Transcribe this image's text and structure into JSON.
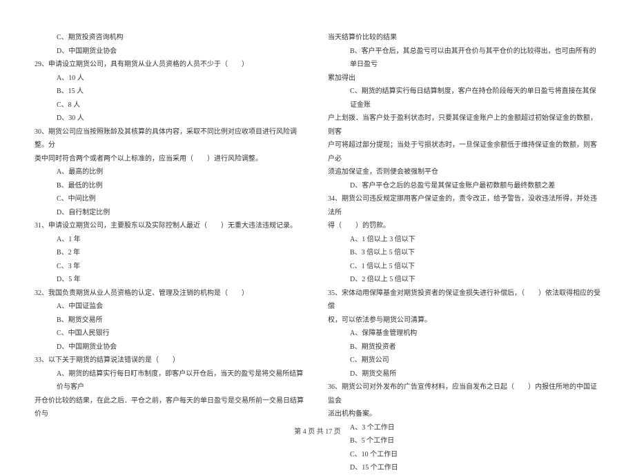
{
  "left": {
    "l0": "C、期货投资咨询机构",
    "l1": "D、中国期货业协会",
    "l2": "29、申请设立期货公司，具有期货从业人员资格的人员不少于（　　）",
    "l3": "A、10 人",
    "l4": "B、15 人",
    "l5": "C、8 人",
    "l6": "D、30 人",
    "l7": "30、期货公司应当按照账龄及其核算的具体内容，采取不同比例对应收项目进行风险调整。分",
    "l8": "类中同时符合两个或者两个以上标准的，应当采用（　　）进行风险调整。",
    "l9": "A、最高的比例",
    "l10": "B、最低的比例",
    "l11": "C、中间比例",
    "l12": "D、自行制定比例",
    "l13": "31、申请设立期货公司，主要股东以及实际控制人最近（　　）无重大违法违规记录。",
    "l14": "A、1 年",
    "l15": "B、2 年",
    "l16": "C、3 年",
    "l17": "D、5 年",
    "l18": "32、我国负责期货从业人员资格的认定、管理及注销的机构是（　　）",
    "l19": "A、中国证监会",
    "l20": "B、期货交易所",
    "l21": "C、中国人民银行",
    "l22": "D、中国期货业协会",
    "l23": "33、以下关于期货的结算说法错误的是（　　）",
    "l24": "A、期货的结算实行每日盯市制度，即客户以开仓后，当天的盈亏是将交易所结算价与客户",
    "l25": "开仓价比较的结果，在此之后．平仓之前，客户每天的单日盈亏是交易所前一交易日结算价与"
  },
  "right": {
    "r0": "当天结算价比较的结果",
    "r1": "B、客户平仓后，其总盈亏可以由其开仓价与其平仓价的比较得出，也可由所有的单日盈亏",
    "r2": "累加得出",
    "r3": "C、期货的结算实行每日结算制度，客户在持仓阶段每天的单日盈亏将直接在其保证金账",
    "r4": "户上划拨．当客户处于盈利状态时，只要其保证金账户上的金额超过初始保证金的数额，则客",
    "r5": "户可将超过部分提现；当处于亏损状态时，一旦保证金余额低于维持保证金的数额，则客户必",
    "r6": "须追加保证金，否则便会被强制平仓",
    "r7": "D、客户平仓之后的总盈亏是其保证金账户最初数额与最终数额之差",
    "r8": "34、期货公司违反规定挪用客户保证金的，责令改正，给予警告，没收违法所得，并处违法所",
    "r9": "得（　　）的罚款。",
    "r10": "A、1 倍以上 3 倍以下",
    "r11": "B、3 倍以上 5 倍以下",
    "r12": "C、1 倍以上 5 倍以下",
    "r13": "D、2 倍以上 5 倍以下",
    "r14": "35、宋体动用保障基金对期货投资者的保证金损失进行补偿后，（　　）依法取得相应的受偿",
    "r15": "权，可以依法参与期货公司清算。",
    "r16": "A、保障基金管理机构",
    "r17": "B、期货投资者",
    "r18": "C、期货公司",
    "r19": "D、期货交易所",
    "r20": "36、期货公司对外发布的广告宣传材料，应当自发布之日起（　　）内报住所地的中国证监会",
    "r21": "派出机构备案。",
    "r22": "A、3 个工作日",
    "r23": "B、5 个工作日",
    "r24": "C、10 个工作日",
    "r25": "D、15 个工作日"
  },
  "footer": "第 4 页  共 17 页"
}
